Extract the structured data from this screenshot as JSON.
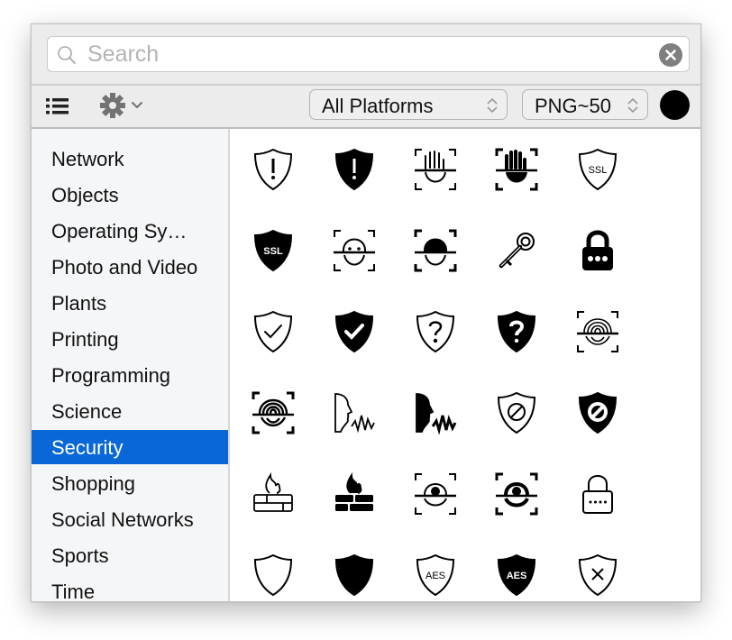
{
  "search": {
    "placeholder": "Search",
    "value": ""
  },
  "toolbar": {
    "platform_selected": "All Platforms",
    "format_selected": "PNG~50",
    "color": "#000000"
  },
  "sidebar": {
    "selected": "Security",
    "items": [
      {
        "label": "Network"
      },
      {
        "label": "Objects"
      },
      {
        "label": "Operating Sy…"
      },
      {
        "label": "Photo and Video"
      },
      {
        "label": "Plants"
      },
      {
        "label": "Printing"
      },
      {
        "label": "Programming"
      },
      {
        "label": "Science"
      },
      {
        "label": "Security"
      },
      {
        "label": "Shopping"
      },
      {
        "label": "Social Networks"
      },
      {
        "label": "Sports"
      },
      {
        "label": "Time"
      }
    ]
  },
  "colors": {
    "accent": "#0a68d6",
    "icon": "#000000"
  },
  "icons": [
    {
      "name": "shield-exclamation-outline-icon",
      "text": ""
    },
    {
      "name": "shield-exclamation-filled-icon",
      "text": ""
    },
    {
      "name": "palm-scan-outline-icon",
      "text": ""
    },
    {
      "name": "palm-scan-filled-icon",
      "text": ""
    },
    {
      "name": "shield-ssl-outline-icon",
      "text": "SSL"
    },
    {
      "name": "shield-ssl-filled-icon",
      "text": "SSL"
    },
    {
      "name": "face-id-outline-icon",
      "text": ""
    },
    {
      "name": "face-id-filled-icon",
      "text": ""
    },
    {
      "name": "key-icon",
      "text": ""
    },
    {
      "name": "password-lock-filled-icon",
      "text": ""
    },
    {
      "name": "shield-check-outline-icon",
      "text": ""
    },
    {
      "name": "shield-check-filled-icon",
      "text": ""
    },
    {
      "name": "shield-question-outline-icon",
      "text": ""
    },
    {
      "name": "shield-question-filled-icon",
      "text": ""
    },
    {
      "name": "fingerprint-scan-outline-icon",
      "text": ""
    },
    {
      "name": "fingerprint-scan-filled-icon",
      "text": ""
    },
    {
      "name": "voice-id-outline-icon",
      "text": ""
    },
    {
      "name": "voice-id-filled-icon",
      "text": ""
    },
    {
      "name": "shield-block-outline-icon",
      "text": ""
    },
    {
      "name": "shield-block-filled-icon",
      "text": ""
    },
    {
      "name": "firewall-outline-icon",
      "text": ""
    },
    {
      "name": "firewall-filled-icon",
      "text": ""
    },
    {
      "name": "iris-scan-outline-icon",
      "text": ""
    },
    {
      "name": "iris-scan-filled-icon",
      "text": ""
    },
    {
      "name": "password-lock-outline-icon",
      "text": ""
    },
    {
      "name": "shield-outline-icon",
      "text": ""
    },
    {
      "name": "shield-filled-icon",
      "text": ""
    },
    {
      "name": "shield-aes-outline-icon",
      "text": "AES"
    },
    {
      "name": "shield-aes-filled-icon",
      "text": "AES"
    },
    {
      "name": "shield-x-outline-icon",
      "text": ""
    }
  ]
}
